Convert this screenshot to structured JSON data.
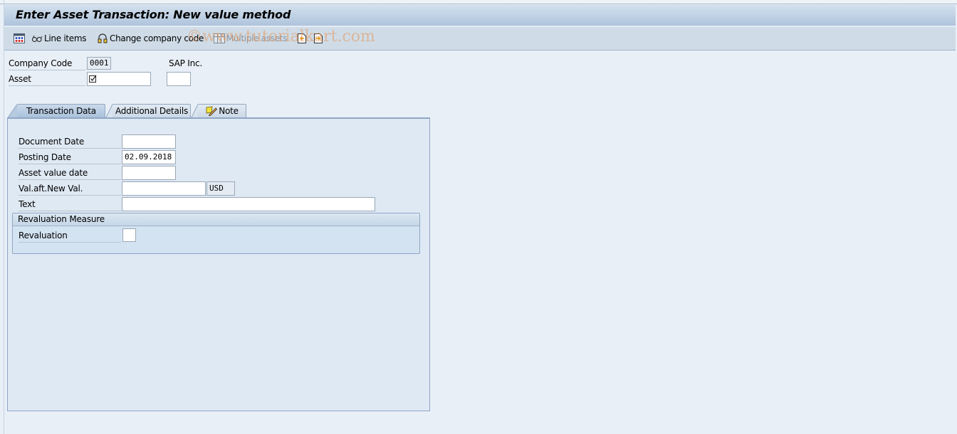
{
  "window": {
    "title": "Enter Asset Transaction: New value method"
  },
  "toolbar": {
    "items": [
      {
        "icon": "multiple-selection-icon",
        "label": ""
      },
      {
        "icon": "glasses-icon",
        "label": "Line items"
      },
      {
        "icon": "headset-icon",
        "label": "Change company code"
      },
      {
        "icon": "grid-table-icon",
        "label": "Multiple assets",
        "disabled": true
      },
      {
        "icon": "previous-document-icon",
        "label": ""
      },
      {
        "icon": "next-document-icon",
        "label": ""
      }
    ]
  },
  "watermark": "©www.tutorialkart.com",
  "header": {
    "company_code_label": "Company Code",
    "company_code_value": "0001",
    "company_name": "SAP Inc.",
    "asset_label": "Asset",
    "asset_value": "",
    "asset_subnumber_value": ""
  },
  "tabs": [
    {
      "label": "Transaction Data",
      "active": true
    },
    {
      "label": "Additional Details",
      "active": false
    },
    {
      "label": "Note",
      "active": false,
      "icon": "note-pencil-icon"
    }
  ],
  "transaction_data": {
    "fields": [
      {
        "label": "Document Date",
        "value": ""
      },
      {
        "label": "Posting Date",
        "value": "02.09.2018"
      },
      {
        "label": "Asset value date",
        "value": ""
      },
      {
        "label": "Val.aft.New Val.",
        "value": "",
        "currency": "USD"
      },
      {
        "label": "Text",
        "value": ""
      }
    ],
    "revaluation_group": {
      "title": "Revaluation Measure",
      "revaluation_label": "Revaluation",
      "revaluation_value": ""
    }
  }
}
